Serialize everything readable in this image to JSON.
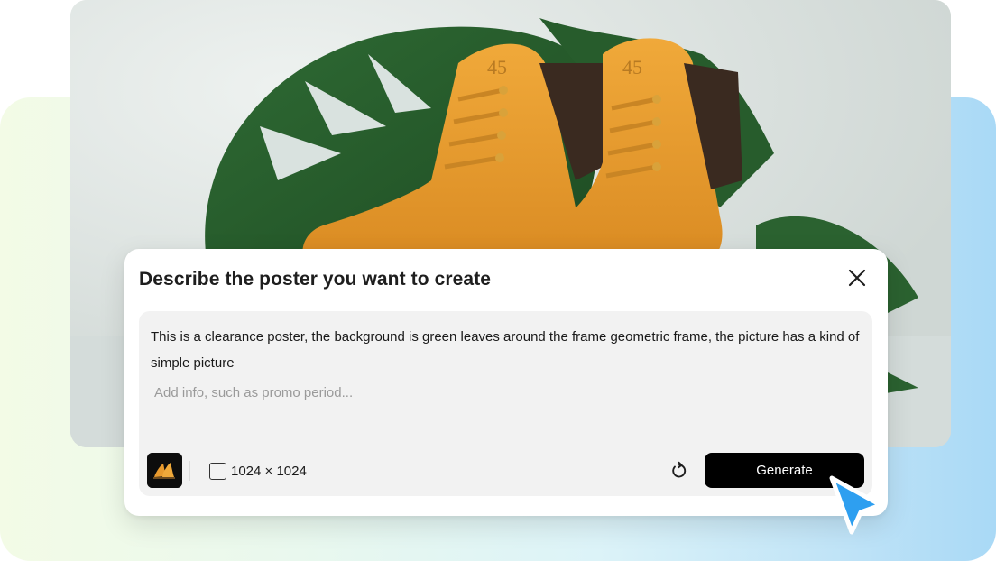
{
  "photo": {
    "subject": "orange-leather-boots-with-monstera-leaf",
    "boot_emblem": "45"
  },
  "dialog": {
    "title": "Describe the poster you want to create",
    "close_icon": "close-icon",
    "prompt_text": "This is a clearance poster, the background is green leaves around the frame geometric frame, the picture has a kind of simple picture",
    "extra_placeholder": "Add info, such as promo period...",
    "size_label": "1024 × 1024",
    "generate_label": "Generate",
    "refresh_icon": "refresh-icon"
  },
  "colors": {
    "accent_cursor": "#2e9ff0",
    "button_bg": "#000000",
    "boot_orange": "#e89a2e"
  }
}
